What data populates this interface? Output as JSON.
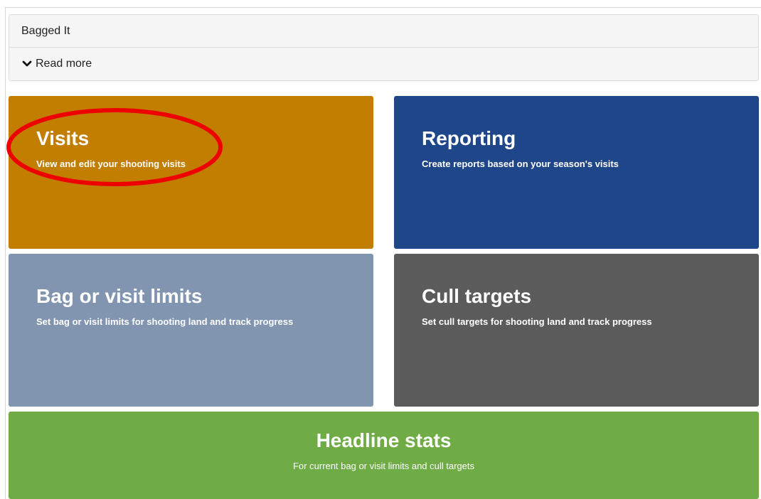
{
  "panel": {
    "title": "Bagged It",
    "toggle_label": "Read more",
    "toggle_icon": "chevron-down-icon"
  },
  "tiles": {
    "visits": {
      "title": "Visits",
      "description": "View and edit your shooting visits",
      "color": "#c27e00"
    },
    "reporting": {
      "title": "Reporting",
      "description": "Create reports based on your season's visits",
      "color": "#1f4688"
    },
    "limits": {
      "title": "Bag or visit limits",
      "description": "Set bag or visit limits for shooting land and track progress",
      "color": "#8295b0"
    },
    "cull": {
      "title": "Cull targets",
      "description": "Set cull targets for shooting land and track progress",
      "color": "#5b5b5b"
    },
    "stats": {
      "title": "Headline stats",
      "description": "For current bag or visit limits and cull targets",
      "color": "#6fac46"
    }
  },
  "annotation": {
    "shape": "ellipse",
    "color": "#ee0000",
    "target": "visits"
  }
}
